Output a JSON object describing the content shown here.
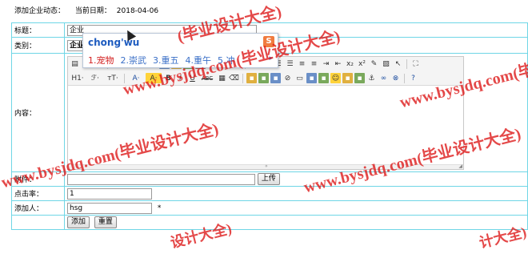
{
  "header": {
    "section_title": "添加企业动态：",
    "date_label": "当前日期：",
    "date_value": "2018-04-06"
  },
  "form": {
    "title_label": "标题：",
    "title_value": "企业",
    "category_label": "类别：",
    "category_value": "企业",
    "content_label": "内容：",
    "attachment_label": "附件：",
    "upload_button": "上传",
    "clicks_label": "点击率：",
    "clicks_value": "1",
    "added_by_label": "添加人：",
    "added_by_value": "hsg",
    "required_mark": "*",
    "submit_button": "添加",
    "reset_button": "重置"
  },
  "editor": {
    "toolbar_row1": [
      "doc-icon",
      "undo-icon",
      "redo-icon",
      "cut-icon",
      "copy-icon",
      "paste-icon",
      "find-icon",
      "bold-icon",
      "italic-icon",
      "underline-icon",
      "strike-icon",
      "align-left-icon",
      "align-center-icon",
      "align-right-icon",
      "justify-icon",
      "ordered-list-icon",
      "unordered-list-icon",
      "indent-icon",
      "outdent-icon",
      "subscript-icon",
      "superscript-icon",
      "clear-format-icon",
      "select-all-icon",
      "select-icon",
      "fullscreen-icon"
    ],
    "toolbar_row2_text": {
      "heading": "H1·",
      "font_family": "ℱ·",
      "font_size": "тT·",
      "font_color": "A·",
      "highlight": "A·",
      "bold": "B",
      "italic": "I",
      "underline": "U",
      "strike": "ABC"
    },
    "toolbar_row2_icons": [
      "table-icon",
      "eraser-icon",
      "image-icon",
      "flash-icon",
      "media-icon",
      "attach-icon",
      "map-icon",
      "code-icon",
      "emoticon-icon",
      "template-icon",
      "pagebreak-icon",
      "anchor-icon",
      "link-icon",
      "unlink-icon",
      "help-icon"
    ]
  },
  "ime": {
    "pinyin": "chong'wu",
    "logo": "S",
    "candidates": [
      "1.宠物",
      "2.崇武",
      "3.重五",
      "4.重午",
      "5.冲"
    ],
    "next_page": "▸"
  },
  "watermark": {
    "text": "www.bysjdq.com(毕业设计大全)",
    "short": "(毕业设计大全)",
    "fragment": "设计大全)",
    "tail": "计大全)"
  }
}
